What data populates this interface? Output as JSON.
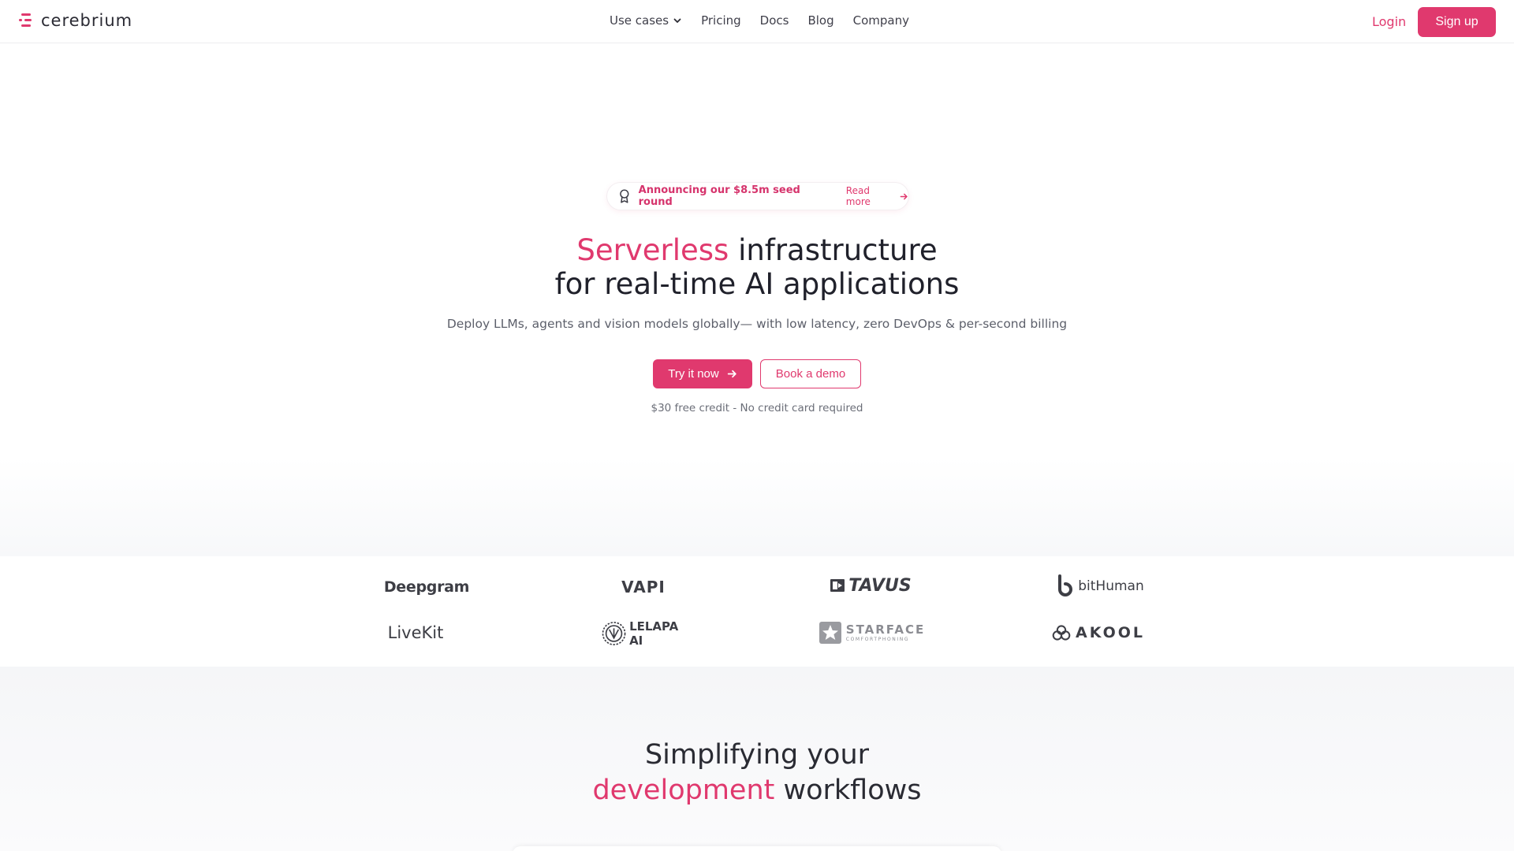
{
  "nav": {
    "brand": "cerebrium",
    "links": [
      "Use cases",
      "Pricing",
      "Docs",
      "Blog",
      "Company"
    ],
    "login": "Login",
    "signup": "Sign up"
  },
  "hero": {
    "announcement": "Announcing our $8.5m seed round",
    "announcement_link": "Read more",
    "title_accent": "Serverless",
    "title_rest_line1": " infrastructure",
    "title_line2": "for real-time AI applications",
    "subtitle": "Deploy LLMs, agents and vision models globally— with low latency, zero DevOps & per-second billing",
    "cta_primary": "Try it now",
    "cta_secondary": "Book a demo",
    "credit_note": "$30 free credit - No credit card required"
  },
  "customers": {
    "logos": [
      "Deepgram",
      "VAPI",
      "TAVUS",
      "bitHuman",
      "LiveKit",
      "LELAPA AI",
      "STARFACE",
      "AKOOL"
    ],
    "starface_tagline": "COMFORTPHONING"
  },
  "section2": {
    "title_line1": "Simplifying your",
    "title_accent": "development",
    "title_rest": " workflows"
  },
  "colors": {
    "accent": "#e0396e",
    "text": "#20212b",
    "muted": "#5c5f6a"
  }
}
